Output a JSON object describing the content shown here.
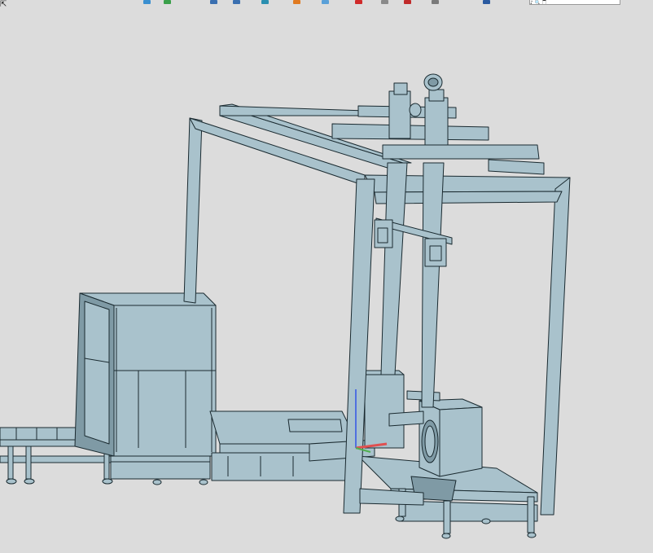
{
  "window": {
    "corner_text": "⇱"
  },
  "toolbar": {
    "icons": [
      {
        "name": "part-icon",
        "color": "#3a8fd0"
      },
      {
        "name": "sketch-icon",
        "color": "#3aa04a"
      },
      {
        "name": "view-cube-icon",
        "color": "#3a6fb0"
      },
      {
        "name": "shaded-view-icon",
        "color": "#3a6fb0"
      },
      {
        "name": "section-view-icon",
        "color": "#2a8fb0"
      },
      {
        "name": "appearance-icon",
        "color": "#e07a20"
      },
      {
        "name": "scene-icon",
        "color": "#5aa0d8"
      },
      {
        "name": "measure-icon",
        "color": "#d02a2a"
      },
      {
        "name": "display-icon",
        "color": "#8a8a8a"
      },
      {
        "name": "hide-show-icon",
        "color": "#c02a2a"
      },
      {
        "name": "settings-icon",
        "color": "#7a7a7a"
      },
      {
        "name": "help-icon",
        "color": "#2a5aa0"
      }
    ],
    "search_value": "♪ 🔍 🀆"
  },
  "model": {
    "base_color": "#a9c2cc",
    "edge_color": "#1a2a30",
    "dark_panel_color": "#7f9aa5",
    "triad": {
      "x_color": "#e05050",
      "y_color": "#50b050",
      "z_color": "#5070e0"
    }
  }
}
